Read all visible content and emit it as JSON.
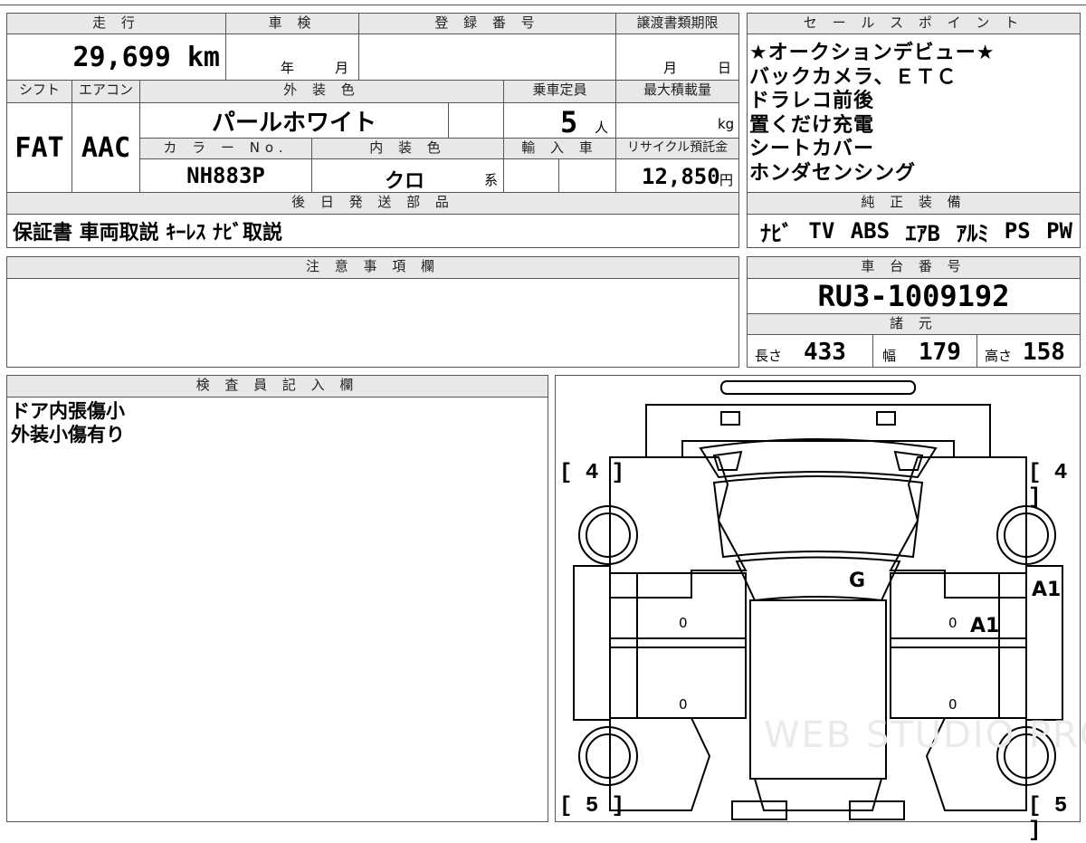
{
  "mileage": {
    "header": "走 行",
    "value": "29,699 km"
  },
  "inspection": {
    "header": "車 検",
    "year_label": "年",
    "month_label": "月"
  },
  "registration": {
    "header": "登 録 番 号",
    "value": ""
  },
  "transfer": {
    "header": "譲渡書類期限",
    "month_label": "月",
    "day_label": "日"
  },
  "shift": {
    "header": "シフト",
    "value": "FAT"
  },
  "aircon": {
    "header": "エアコン",
    "value": "AAC"
  },
  "exterior_color": {
    "header": "外 装 色",
    "value": "パールホワイト"
  },
  "capacity": {
    "header": "乗車定員",
    "value": "5",
    "unit": "人"
  },
  "max_load": {
    "header": "最大積載量",
    "value": "",
    "unit": "kg"
  },
  "color_no": {
    "header": "カ ラ ー No.",
    "value": "NH883P"
  },
  "interior_color": {
    "header": "内 装 色",
    "value": "クロ",
    "suffix": "系"
  },
  "import": {
    "header": "輸 入 車",
    "value": ""
  },
  "recycle": {
    "header": "リサイクル預託金",
    "value": "12,850",
    "unit": "円"
  },
  "later_parts": {
    "header": "後 日 発 送 部 品",
    "items": "保証書 車両取説 ｷｰﾚｽ ﾅﾋﾞ取説"
  },
  "sales_points": {
    "header": "セ ー ル ス ポ イ ン ト",
    "lines": [
      "★オークションデビュー★",
      "バックカメラ、ＥＴＣ",
      "ドラレコ前後",
      "置くだけ充電",
      "シートカバー",
      "ホンダセンシング"
    ]
  },
  "genuine_equipment": {
    "header": "純 正 装 備",
    "items": [
      "ﾅﾋﾞ",
      "TV",
      "ABS",
      "ｴｱB",
      "ｱﾙﾐ",
      "PS",
      "PW"
    ]
  },
  "notes": {
    "header": "注 意 事 項 欄",
    "text": ""
  },
  "chassis": {
    "header": "車 台 番 号",
    "value": "RU3-1009192"
  },
  "specs": {
    "header": "諸 元",
    "length_label": "長さ",
    "length": "433",
    "width_label": "幅",
    "width": "179",
    "height_label": "高さ",
    "height": "158"
  },
  "inspector": {
    "header": "検 査 員 記 入 欄",
    "lines": [
      "ドア内張傷小",
      "外装小傷有り"
    ]
  },
  "diagram": {
    "tire_front_left": "4",
    "tire_front_right": "4",
    "tire_rear_left": "5",
    "tire_rear_right": "5",
    "marks": {
      "glass": "G",
      "right_panel": "A1",
      "right_door_front": "A1"
    },
    "door_zeros": [
      "0",
      "0",
      "0",
      "0"
    ],
    "watermark": "WEB STUDIO PRO"
  }
}
